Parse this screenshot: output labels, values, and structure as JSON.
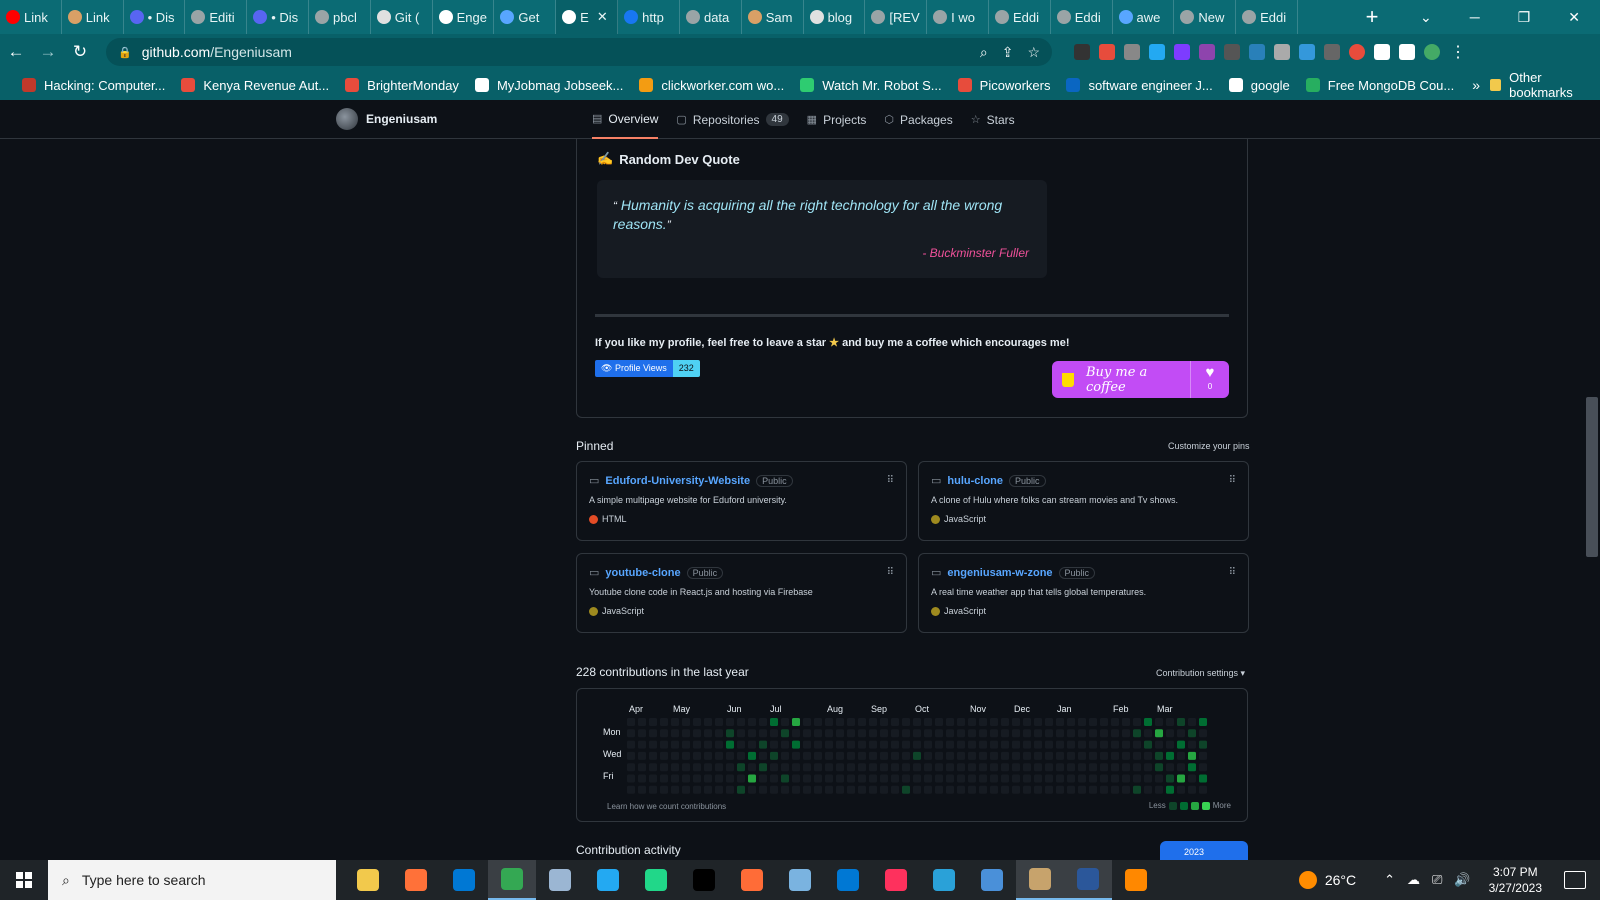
{
  "browser": {
    "tabs": [
      {
        "label": "Link",
        "icon": "youtube-icon",
        "color": "#ff0000"
      },
      {
        "label": "Link",
        "icon": "page-icon",
        "color": "#d9a066"
      },
      {
        "label": "• Dis",
        "icon": "chat-icon",
        "color": "#5865f2"
      },
      {
        "label": "Editi",
        "icon": "github-icon",
        "color": "#9aa4a6"
      },
      {
        "label": "• Dis",
        "icon": "chat-icon",
        "color": "#5865f2"
      },
      {
        "label": "pbcl",
        "icon": "github-icon",
        "color": "#9aa4a6"
      },
      {
        "label": "Git (",
        "icon": "git-icon",
        "color": "#e0e0e0"
      },
      {
        "label": "Enge",
        "icon": "globe-icon",
        "color": "#ffffff"
      },
      {
        "label": "Get",
        "icon": "flag-icon",
        "color": "#58a6ff"
      },
      {
        "label": "E",
        "icon": "github-icon",
        "color": "#ffffff",
        "active": true
      },
      {
        "label": "http",
        "icon": "facebook-icon",
        "color": "#1877f2"
      },
      {
        "label": "data",
        "icon": "github-icon",
        "color": "#9aa4a6"
      },
      {
        "label": "Sam",
        "icon": "feather-icon",
        "color": "#d9a066"
      },
      {
        "label": "blog",
        "icon": "globe-icon",
        "color": "#e0e0e0"
      },
      {
        "label": "[REV",
        "icon": "github-icon",
        "color": "#9aa4a6"
      },
      {
        "label": "I wo",
        "icon": "github-icon",
        "color": "#9aa4a6"
      },
      {
        "label": "Eddi",
        "icon": "github-icon",
        "color": "#9aa4a6"
      },
      {
        "label": "Eddi",
        "icon": "github-icon",
        "color": "#9aa4a6"
      },
      {
        "label": "awe",
        "icon": "loading-icon",
        "color": "#58a6ff"
      },
      {
        "label": "New",
        "icon": "github-icon",
        "color": "#9aa4a6"
      },
      {
        "label": "Eddi",
        "icon": "github-icon",
        "color": "#9aa4a6"
      }
    ],
    "url_host": "github.com",
    "url_path": "/Engeniusam",
    "bookmarks": [
      {
        "label": "Hacking: Computer...",
        "color": "#c0392b"
      },
      {
        "label": "Kenya Revenue Aut...",
        "color": "#e74c3c"
      },
      {
        "label": "BrighterMonday",
        "color": "#e74c3c"
      },
      {
        "label": "MyJobmag Jobseek...",
        "color": "#ffffff"
      },
      {
        "label": "clickworker.com wo...",
        "color": "#f39c12"
      },
      {
        "label": "Watch Mr. Robot S...",
        "color": "#2ecc71"
      },
      {
        "label": "Picoworkers",
        "color": "#e74c3c"
      },
      {
        "label": "software engineer J...",
        "color": "#0a66c2"
      },
      {
        "label": "google",
        "color": "#ffffff"
      },
      {
        "label": "Free MongoDB Cou...",
        "color": "#27ae60"
      }
    ],
    "other_bookmarks": "Other bookmarks"
  },
  "profile_nav": {
    "username": "Engeniusam",
    "tabs": [
      {
        "label": "Overview",
        "icon": "book-icon",
        "active": true
      },
      {
        "label": "Repositories",
        "icon": "repo-icon",
        "count": "49"
      },
      {
        "label": "Projects",
        "icon": "table-icon"
      },
      {
        "label": "Packages",
        "icon": "package-icon"
      },
      {
        "label": "Stars",
        "icon": "star-icon"
      }
    ]
  },
  "readme": {
    "quote_heading": "Random Dev Quote",
    "quote_text": "Humanity is acquiring all the right technology for all the wrong reasons.",
    "quote_author": "- Buckminster Fuller",
    "coffee_line_before": "If you like my profile, feel free to leave a star",
    "coffee_line_after": "and buy me a coffee which encourages me!",
    "views_label": "Profile Views",
    "views_count": "232",
    "bmc_label": "Buy me a coffee",
    "bmc_count": "0"
  },
  "pinned": {
    "title": "Pinned",
    "customize": "Customize your pins",
    "repos": [
      {
        "name": "Eduford-University-Website",
        "visibility": "Public",
        "description": "A simple multipage website for Eduford university.",
        "language": "HTML",
        "lang_color": "#e34c26"
      },
      {
        "name": "hulu-clone",
        "visibility": "Public",
        "description": "A clone of Hulu where folks can stream movies and Tv shows.",
        "language": "JavaScript",
        "lang_color": "#9e8a1f"
      },
      {
        "name": "youtube-clone",
        "visibility": "Public",
        "description": "Youtube clone code in React.js and hosting via Firebase",
        "language": "JavaScript",
        "lang_color": "#9e8a1f"
      },
      {
        "name": "engeniusam-w-zone",
        "visibility": "Public",
        "description": "A real time weather app that tells global temperatures.",
        "language": "JavaScript",
        "lang_color": "#9e8a1f"
      }
    ]
  },
  "contributions": {
    "title": "228 contributions in the last year",
    "settings": "Contribution settings ▾",
    "months": [
      "Apr",
      "May",
      "Jun",
      "Jul",
      "Aug",
      "Sep",
      "Oct",
      "Nov",
      "Dec",
      "Jan",
      "Feb",
      "Mar"
    ],
    "days": [
      "Mon",
      "Wed",
      "Fri"
    ],
    "learn": "Learn how we count contributions",
    "less": "Less",
    "more": "More",
    "level_colors": [
      "#161b22",
      "#0e4429",
      "#006d32",
      "#26a641",
      "#39d353"
    ]
  },
  "activity": {
    "title": "Contribution activity",
    "year": "2023"
  },
  "taskbar": {
    "search_placeholder": "Type here to search",
    "apps": [
      {
        "icon": "file-explorer-icon",
        "color": "#f2c94c"
      },
      {
        "icon": "firefox-icon",
        "color": "#ff7139"
      },
      {
        "icon": "store-icon",
        "color": "#0078d4"
      },
      {
        "icon": "chrome-icon",
        "color": "#34a853",
        "active": true
      },
      {
        "icon": "virtualbox-icon",
        "color": "#9bb6d3"
      },
      {
        "icon": "vscode-icon",
        "color": "#23a9f2"
      },
      {
        "icon": "pycharm-icon",
        "color": "#21d789"
      },
      {
        "icon": "hfm-icon",
        "color": "#000000"
      },
      {
        "icon": "postman-icon",
        "color": "#ff6c37"
      },
      {
        "icon": "box-icon",
        "color": "#7ab3e0"
      },
      {
        "icon": "word-blue-icon",
        "color": "#0078d4"
      },
      {
        "icon": "intellij-icon",
        "color": "#fe315d"
      },
      {
        "icon": "settings-app-icon",
        "color": "#2aa1d8"
      },
      {
        "icon": "network-icon",
        "color": "#4a90d9"
      },
      {
        "icon": "image-viewer-icon",
        "color": "#c7a36c",
        "active": true
      },
      {
        "icon": "word-icon",
        "color": "#2b579a",
        "active": true
      },
      {
        "icon": "vlc-icon",
        "color": "#ff8800"
      }
    ],
    "temperature": "26°C",
    "time": "3:07 PM",
    "date": "3/27/2023"
  }
}
